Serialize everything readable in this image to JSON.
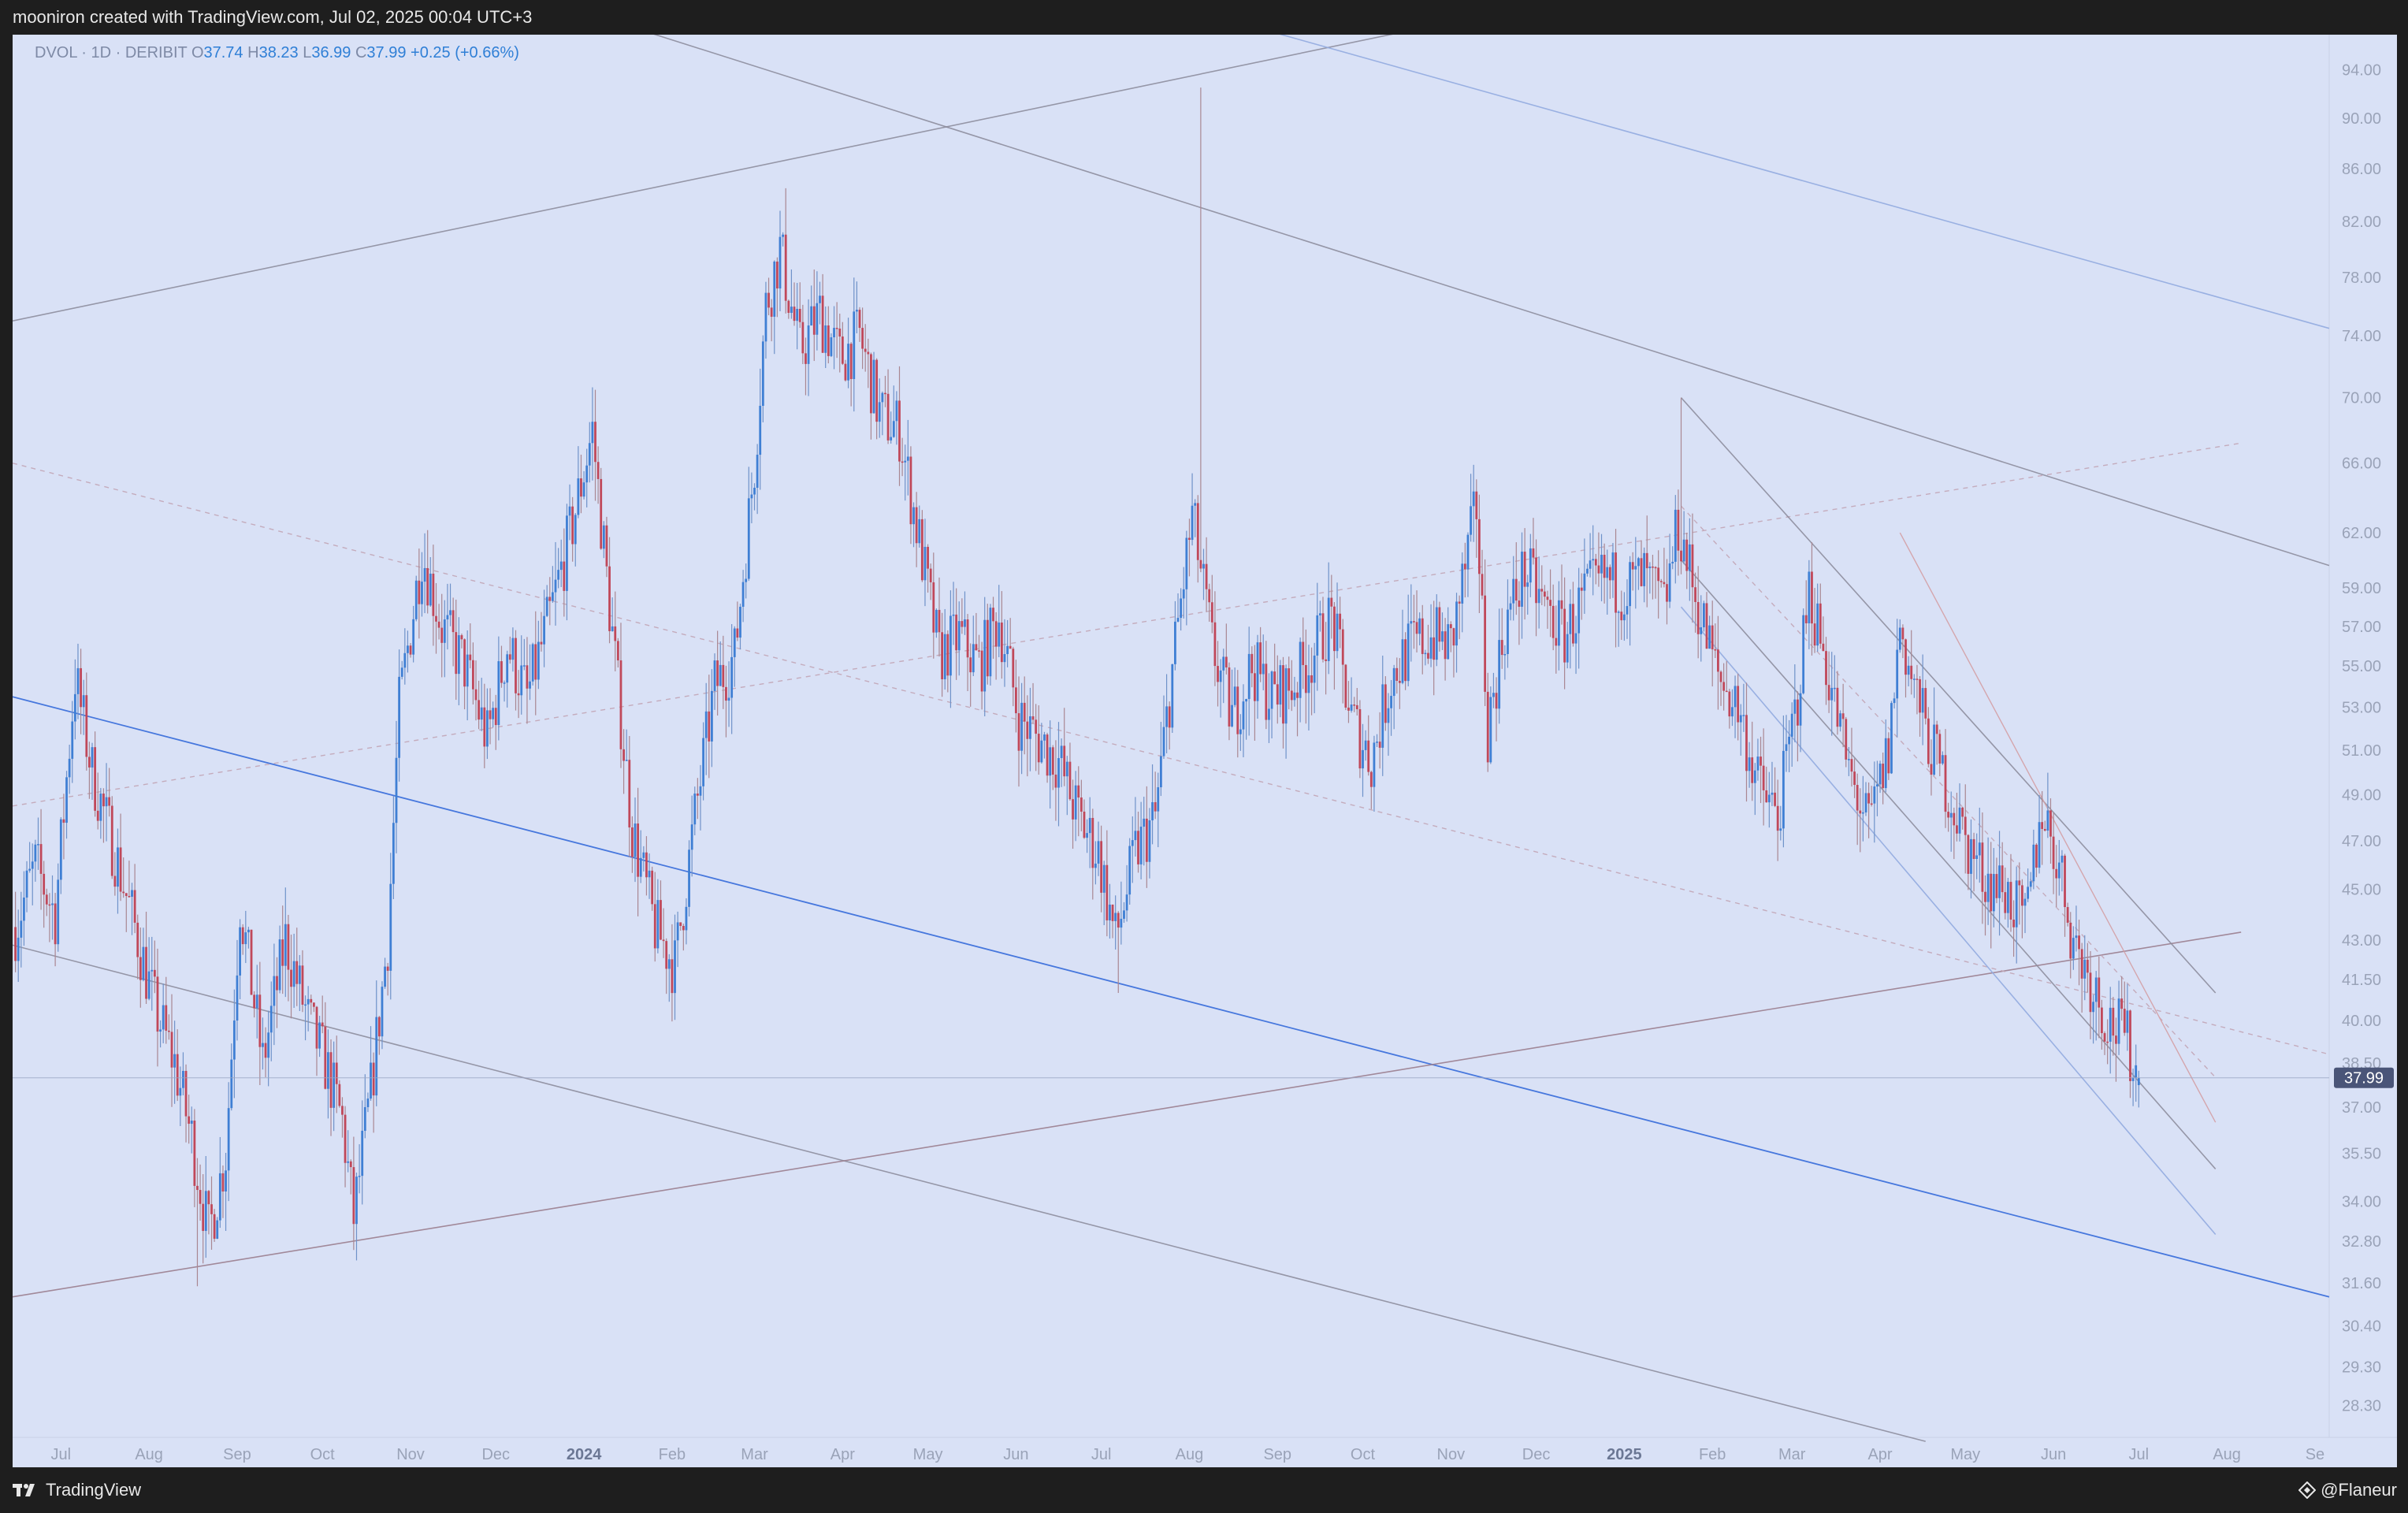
{
  "banner": "mooniron created with TradingView.com, Jul 02, 2025 00:04 UTC+3",
  "legend": {
    "symbol": "DVOL · 1D · DERIBIT",
    "open_label": "O",
    "open": "37.74",
    "high_label": "H",
    "high": "38.23",
    "low_label": "L",
    "low": "36.99",
    "close_label": "C",
    "close": "37.99",
    "change": "+0.25 (+0.66%)"
  },
  "footer": {
    "brand": "TradingView",
    "author": "@Flaneur"
  },
  "icons": {
    "brand_logo": "tradingview-logo",
    "author_icon": "binance-diamond-icon"
  },
  "colors": {
    "background": "#d9e1f6",
    "up": "#3f7fd4",
    "down": "#c0485a",
    "price_tag": "#4a5578",
    "blue_line": "#4677dd",
    "gray_line": "#8a8a9a",
    "mauve_line": "#9b7f8f",
    "dashed_line": "#c2a6b6"
  },
  "chart_data": {
    "type": "candlestick",
    "scale": "log",
    "ylim": [
      27.5,
      97.0
    ],
    "y_ticks": [
      "94.00",
      "90.00",
      "86.00",
      "82.00",
      "78.00",
      "74.00",
      "70.00",
      "66.00",
      "62.00",
      "59.00",
      "57.00",
      "55.00",
      "53.00",
      "51.00",
      "49.00",
      "47.00",
      "45.00",
      "43.00",
      "41.50",
      "40.00",
      "38.50",
      "37.00",
      "35.50",
      "34.00",
      "32.80",
      "31.60",
      "30.40",
      "29.30",
      "28.30"
    ],
    "x_ticks": [
      "Jul",
      "Aug",
      "Sep",
      "Oct",
      "Nov",
      "Dec",
      "2024",
      "Feb",
      "Mar",
      "Apr",
      "May",
      "Jun",
      "Jul",
      "Aug",
      "Sep",
      "Oct",
      "Nov",
      "Dec",
      "2025",
      "Feb",
      "Mar",
      "Apr",
      "May",
      "Jun",
      "Jul",
      "Aug",
      "Se"
    ],
    "x_range": [
      "2023-06-14",
      "2025-09-06"
    ],
    "last_price": "37.99",
    "closes": [
      {
        "d": "2023-06-15",
        "c": 43.5
      },
      {
        "d": "2023-06-22",
        "c": 46.0
      },
      {
        "d": "2023-06-29",
        "c": 44.0
      },
      {
        "d": "2023-07-06",
        "c": 54.5
      },
      {
        "d": "2023-07-12",
        "c": 50.0
      },
      {
        "d": "2023-07-20",
        "c": 46.5
      },
      {
        "d": "2023-07-27",
        "c": 43.5
      },
      {
        "d": "2023-08-03",
        "c": 40.5
      },
      {
        "d": "2023-08-10",
        "c": 38.5
      },
      {
        "d": "2023-08-16",
        "c": 36.0
      },
      {
        "d": "2023-08-22",
        "c": 33.0
      },
      {
        "d": "2023-08-28",
        "c": 35.5
      },
      {
        "d": "2023-09-02",
        "c": 44.5
      },
      {
        "d": "2023-09-10",
        "c": 38.5
      },
      {
        "d": "2023-09-18",
        "c": 43.0
      },
      {
        "d": "2023-09-26",
        "c": 40.0
      },
      {
        "d": "2023-10-02",
        "c": 38.5
      },
      {
        "d": "2023-10-08",
        "c": 36.5
      },
      {
        "d": "2023-10-12",
        "c": 33.5
      },
      {
        "d": "2023-10-18",
        "c": 37.5
      },
      {
        "d": "2023-10-24",
        "c": 43.0
      },
      {
        "d": "2023-10-28",
        "c": 53.0
      },
      {
        "d": "2023-11-05",
        "c": 61.0
      },
      {
        "d": "2023-11-12",
        "c": 57.0
      },
      {
        "d": "2023-11-20",
        "c": 55.0
      },
      {
        "d": "2023-11-28",
        "c": 51.5
      },
      {
        "d": "2023-12-05",
        "c": 56.0
      },
      {
        "d": "2023-12-12",
        "c": 53.5
      },
      {
        "d": "2023-12-20",
        "c": 57.5
      },
      {
        "d": "2023-12-28",
        "c": 62.5
      },
      {
        "d": "2024-01-04",
        "c": 68.0
      },
      {
        "d": "2024-01-10",
        "c": 58.0
      },
      {
        "d": "2024-01-18",
        "c": 47.5
      },
      {
        "d": "2024-01-26",
        "c": 43.5
      },
      {
        "d": "2024-02-02",
        "c": 42.0
      },
      {
        "d": "2024-02-09",
        "c": 48.0
      },
      {
        "d": "2024-02-16",
        "c": 54.0
      },
      {
        "d": "2024-02-23",
        "c": 55.5
      },
      {
        "d": "2024-03-01",
        "c": 66.0
      },
      {
        "d": "2024-03-05",
        "c": 76.0
      },
      {
        "d": "2024-03-10",
        "c": 80.0
      },
      {
        "d": "2024-03-17",
        "c": 73.0
      },
      {
        "d": "2024-03-24",
        "c": 75.5
      },
      {
        "d": "2024-03-31",
        "c": 72.5
      },
      {
        "d": "2024-04-07",
        "c": 74.0
      },
      {
        "d": "2024-04-14",
        "c": 69.0
      },
      {
        "d": "2024-04-21",
        "c": 68.0
      },
      {
        "d": "2024-04-28",
        "c": 61.5
      },
      {
        "d": "2024-05-05",
        "c": 55.5
      },
      {
        "d": "2024-05-12",
        "c": 56.5
      },
      {
        "d": "2024-05-19",
        "c": 55.0
      },
      {
        "d": "2024-05-26",
        "c": 57.5
      },
      {
        "d": "2024-06-02",
        "c": 52.5
      },
      {
        "d": "2024-06-09",
        "c": 51.5
      },
      {
        "d": "2024-06-16",
        "c": 50.5
      },
      {
        "d": "2024-06-23",
        "c": 48.0
      },
      {
        "d": "2024-06-30",
        "c": 46.5
      },
      {
        "d": "2024-07-06",
        "c": 43.0
      },
      {
        "d": "2024-07-13",
        "c": 46.5
      },
      {
        "d": "2024-07-20",
        "c": 48.0
      },
      {
        "d": "2024-07-27",
        "c": 56.0
      },
      {
        "d": "2024-08-02",
        "c": 63.0
      },
      {
        "d": "2024-08-09",
        "c": 56.0
      },
      {
        "d": "2024-08-16",
        "c": 52.5
      },
      {
        "d": "2024-08-23",
        "c": 55.0
      },
      {
        "d": "2024-08-30",
        "c": 53.5
      },
      {
        "d": "2024-09-06",
        "c": 54.0
      },
      {
        "d": "2024-09-13",
        "c": 55.5
      },
      {
        "d": "2024-09-20",
        "c": 57.5
      },
      {
        "d": "2024-09-27",
        "c": 52.5
      },
      {
        "d": "2024-10-04",
        "c": 50.5
      },
      {
        "d": "2024-10-11",
        "c": 54.5
      },
      {
        "d": "2024-10-18",
        "c": 56.0
      },
      {
        "d": "2024-10-25",
        "c": 56.5
      },
      {
        "d": "2024-11-01",
        "c": 56.0
      },
      {
        "d": "2024-11-06",
        "c": 60.0
      },
      {
        "d": "2024-11-10",
        "c": 63.5
      },
      {
        "d": "2024-11-14",
        "c": 52.0
      },
      {
        "d": "2024-11-20",
        "c": 57.0
      },
      {
        "d": "2024-11-27",
        "c": 60.0
      },
      {
        "d": "2024-12-04",
        "c": 58.0
      },
      {
        "d": "2024-12-11",
        "c": 56.5
      },
      {
        "d": "2024-12-18",
        "c": 58.5
      },
      {
        "d": "2024-12-25",
        "c": 59.5
      },
      {
        "d": "2025-01-01",
        "c": 59.0
      },
      {
        "d": "2025-01-08",
        "c": 59.5
      },
      {
        "d": "2025-01-15",
        "c": 58.0
      },
      {
        "d": "2025-01-20",
        "c": 62.5
      },
      {
        "d": "2025-01-27",
        "c": 58.0
      },
      {
        "d": "2025-02-03",
        "c": 54.5
      },
      {
        "d": "2025-02-10",
        "c": 53.0
      },
      {
        "d": "2025-02-17",
        "c": 49.5
      },
      {
        "d": "2025-02-24",
        "c": 48.0
      },
      {
        "d": "2025-03-03",
        "c": 53.5
      },
      {
        "d": "2025-03-07",
        "c": 59.0
      },
      {
        "d": "2025-03-14",
        "c": 54.5
      },
      {
        "d": "2025-03-21",
        "c": 50.0
      },
      {
        "d": "2025-03-28",
        "c": 47.5
      },
      {
        "d": "2025-04-04",
        "c": 51.0
      },
      {
        "d": "2025-04-08",
        "c": 57.0
      },
      {
        "d": "2025-04-12",
        "c": 54.5
      },
      {
        "d": "2025-04-18",
        "c": 51.5
      },
      {
        "d": "2025-04-24",
        "c": 49.5
      },
      {
        "d": "2025-05-01",
        "c": 47.0
      },
      {
        "d": "2025-05-08",
        "c": 45.5
      },
      {
        "d": "2025-05-15",
        "c": 45.0
      },
      {
        "d": "2025-05-22",
        "c": 43.5
      },
      {
        "d": "2025-05-28",
        "c": 48.5
      },
      {
        "d": "2025-06-03",
        "c": 46.0
      },
      {
        "d": "2025-06-08",
        "c": 43.0
      },
      {
        "d": "2025-06-14",
        "c": 41.5
      },
      {
        "d": "2025-06-20",
        "c": 40.0
      },
      {
        "d": "2025-06-26",
        "c": 39.5
      },
      {
        "d": "2025-07-01",
        "c": 37.99
      }
    ],
    "extremes": [
      {
        "d": "2023-08-18",
        "low": 31.5
      },
      {
        "d": "2024-03-12",
        "high": 84.5
      },
      {
        "d": "2024-08-05",
        "high": 92.5
      },
      {
        "d": "2024-07-07",
        "low": 41.0
      },
      {
        "d": "2025-01-21",
        "high": 70.0
      }
    ],
    "drawings": [
      {
        "style": "gray",
        "p1": [
          "2023-06-14",
          75.0
        ],
        "p2": [
          "2024-11-18",
          99.0
        ]
      },
      {
        "style": "gray",
        "p1": [
          "2024-01-01",
          99.0
        ],
        "p2": [
          "2025-09-06",
          60.2
        ]
      },
      {
        "style": "blue-faint",
        "p1": [
          "2024-08-05",
          99.0
        ],
        "p2": [
          "2025-09-06",
          74.5
        ]
      },
      {
        "style": "blue",
        "p1": [
          "2023-06-14",
          53.5
        ],
        "p2": [
          "2025-09-06",
          31.2
        ]
      },
      {
        "style": "gray",
        "p1": [
          "2023-06-14",
          42.8
        ],
        "p2": [
          "2025-04-17",
          27.4
        ]
      },
      {
        "style": "mauve",
        "p1": [
          "2023-06-14",
          31.2
        ],
        "p2": [
          "2025-08-06",
          43.3
        ]
      },
      {
        "style": "dashed-mauve",
        "p1": [
          "2023-06-14",
          48.5
        ],
        "p2": [
          "2025-08-06",
          67.2
        ]
      },
      {
        "style": "dashed-mauve",
        "p1": [
          "2023-06-14",
          66.0
        ],
        "p2": [
          "2025-09-06",
          38.8
        ]
      },
      {
        "style": "gray",
        "p1": [
          "2025-01-21",
          70.0
        ],
        "p2": [
          "2025-07-28",
          41.0
        ]
      },
      {
        "style": "gray",
        "p1": [
          "2025-01-21",
          60.5
        ],
        "p2": [
          "2025-07-28",
          35.0
        ]
      },
      {
        "style": "blue-faint",
        "p1": [
          "2025-01-21",
          58.0
        ],
        "p2": [
          "2025-07-28",
          33.0
        ]
      },
      {
        "style": "dashed-mauve",
        "p1": [
          "2025-01-21",
          63.5
        ],
        "p2": [
          "2025-07-28",
          38.0
        ]
      },
      {
        "style": "faint-red",
        "p1": [
          "2025-04-08",
          62.0
        ],
        "p2": [
          "2025-07-28",
          36.5
        ]
      }
    ]
  }
}
